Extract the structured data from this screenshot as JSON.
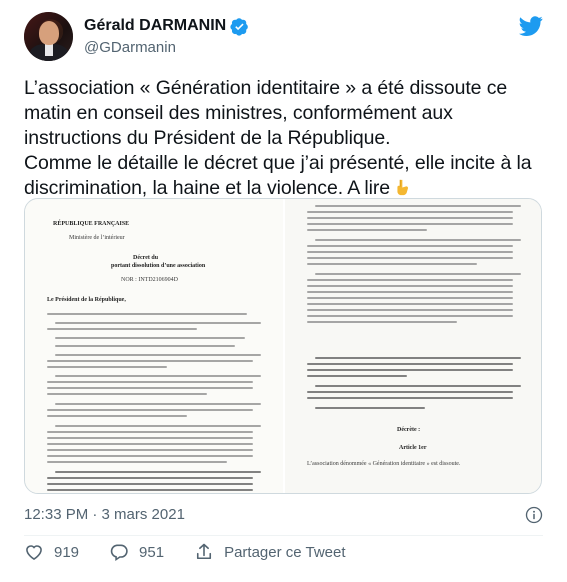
{
  "author": {
    "display_name": "Gérald DARMANIN",
    "handle": "@GDarmanin",
    "verified": true
  },
  "tweet": {
    "text": "L’association « Génération identitaire » a été dissoute ce matin en conseil des ministres, conformément aux instructions du Président de la République.\nComme le détaille le décret que j’ai présenté, elle incite à la discrimination, la haine et la violence. A lire",
    "emoji": "pointing-down-hand"
  },
  "media": {
    "left_page": {
      "header": "RÉPUBLIQUE FRANÇAISE",
      "ministry": "Ministère de l’intérieur",
      "decree_title": "Décret du",
      "decree_subtitle": "portant dissolution d’une association",
      "nor": "NOR : INTD2106904D",
      "intro": "Le Président de la République,"
    },
    "right_page": {
      "heading": "Décrète :",
      "article": "Article 1er",
      "article_text": "L’association dénommée « Génération identitaire » est dissoute."
    }
  },
  "meta": {
    "timestamp": "12:33 PM · 3 mars 2021"
  },
  "actions": {
    "likes": "919",
    "replies": "951",
    "share_label": "Partager ce Tweet"
  },
  "colors": {
    "twitter_blue": "#1d9bf0",
    "like_red": "#f91880",
    "muted": "#536471"
  }
}
